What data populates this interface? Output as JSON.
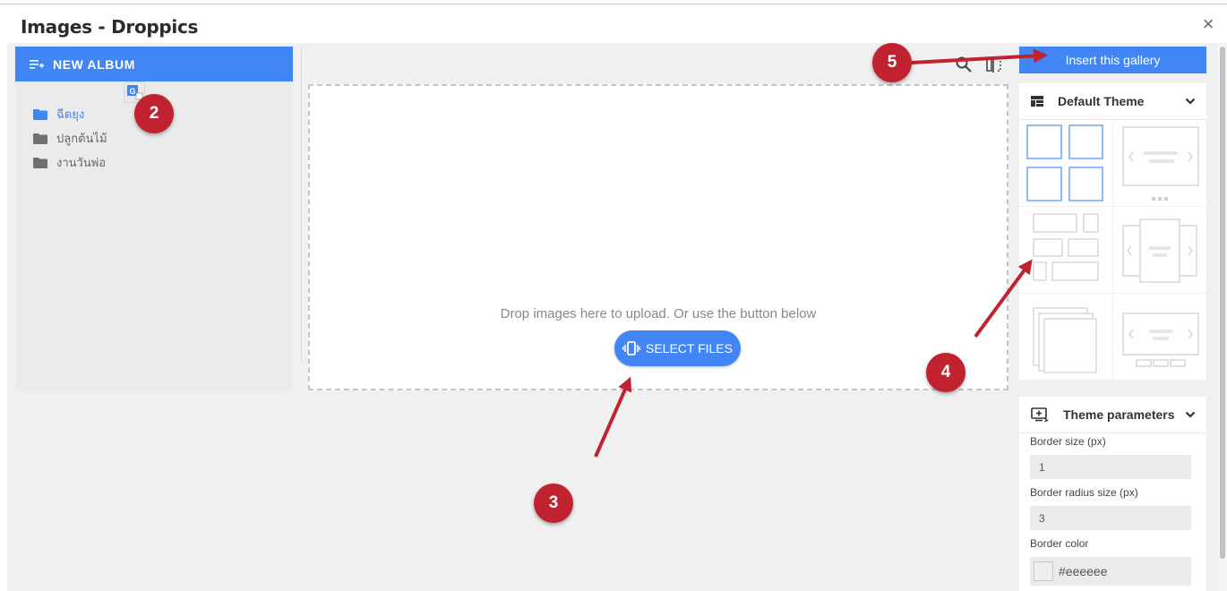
{
  "modal": {
    "title": "Images - Droppics",
    "close_label": "×"
  },
  "sidebar": {
    "new_album_label": "NEW ALBUM",
    "albums": [
      {
        "label": "ฉีดยุง",
        "active": true
      },
      {
        "label": "ปลูกต้นไม้",
        "active": false
      },
      {
        "label": "งานวันพ่อ",
        "active": false
      }
    ]
  },
  "upload": {
    "drop_text": "Drop images here to upload. Or use the button below",
    "select_files_label": "SELECT FILES"
  },
  "right_panel": {
    "insert_label": "Insert this gallery",
    "theme_header": "Default Theme",
    "params_header": "Theme parameters",
    "fields": {
      "border_size_label": "Border size (px)",
      "border_size_value": "1",
      "border_radius_label": "Border radius size (px)",
      "border_radius_value": "3",
      "border_color_label": "Border color",
      "border_color_value": "#eeeeee"
    }
  },
  "annotations": {
    "badge_2": "2",
    "badge_3": "3",
    "badge_4": "4",
    "badge_5": "5"
  },
  "colors": {
    "accent": "#4285f4",
    "badge": "#c0232f",
    "arrow": "#c0232f"
  }
}
